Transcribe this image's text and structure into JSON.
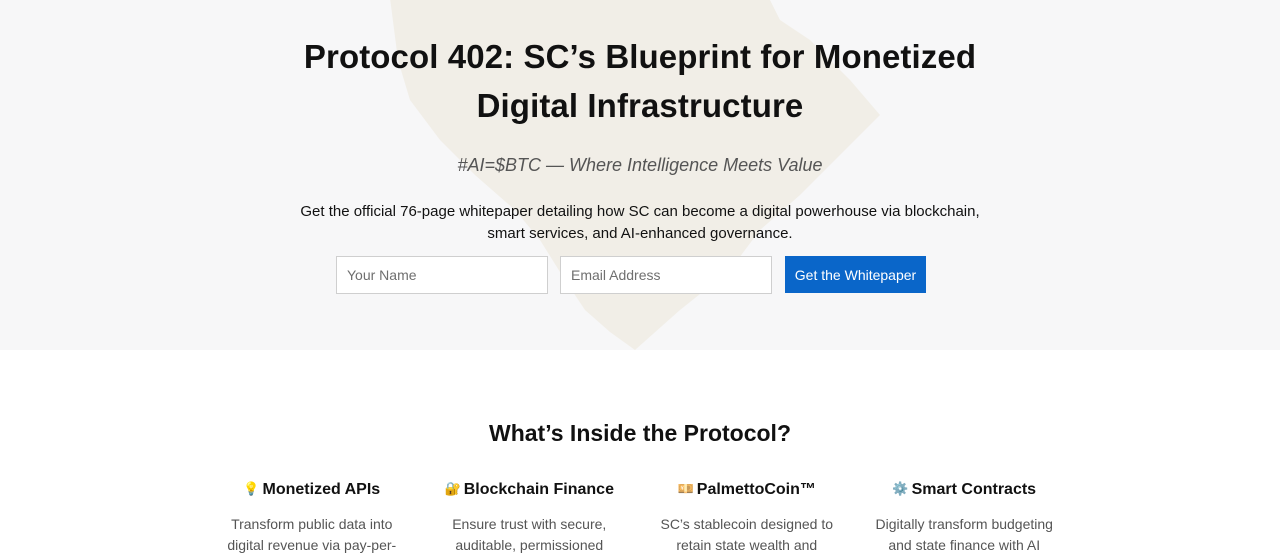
{
  "hero": {
    "title_lines": [
      "Protocol 402: SC’s Blueprint for Monetized",
      "Digital Infrastructure"
    ],
    "tagline": "#AI=$BTC — Where Intelligence Meets Value",
    "intro_lines": [
      "Get the official 76-page whitepaper detailing how SC can become a digital powerhouse via blockchain,",
      "smart services, and AI-enhanced governance."
    ],
    "form": {
      "name_placeholder": "Your Name",
      "name_value": "",
      "email_placeholder": "Email Address",
      "email_value": "",
      "submit_label": "Get the Whitepaper"
    }
  },
  "features": {
    "title": "What’s Inside the Protocol?",
    "items": [
      {
        "icon": "💡",
        "icon_name": "lightbulb-icon",
        "title": "Monetized APIs",
        "desc_lines": [
          "Transform public data into",
          "digital revenue via pay-per-"
        ]
      },
      {
        "icon": "🔐",
        "icon_name": "lock-with-key-icon",
        "title": "Blockchain Finance",
        "desc_lines": [
          "Ensure trust with secure,",
          "auditable, permissioned"
        ]
      },
      {
        "icon": "💴",
        "icon_name": "banknote-icon",
        "title": "PalmettoCoin™",
        "desc_lines": [
          "SC’s stablecoin designed to",
          "retain state wealth and"
        ]
      },
      {
        "icon": "⚙️",
        "icon_name": "gear-icon",
        "title": "Smart Contracts",
        "desc_lines": [
          "Digitally transform budgeting",
          "and state finance with AI"
        ]
      }
    ]
  },
  "colors": {
    "hero_background": "#f7f7f8",
    "button": "#0a66c9",
    "map_watermark": "#efebe2"
  }
}
